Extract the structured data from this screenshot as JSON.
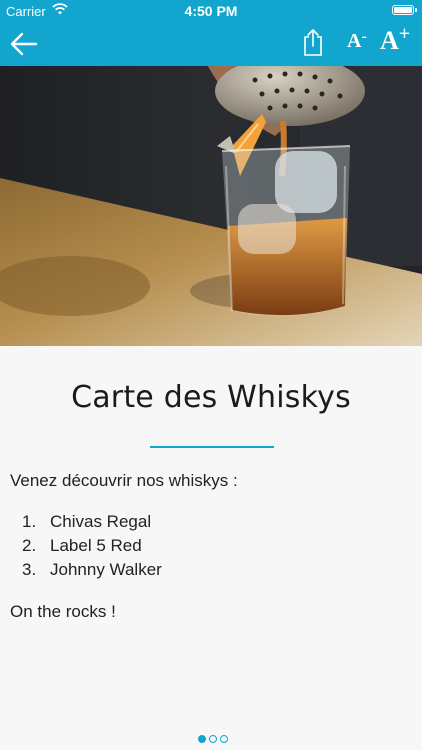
{
  "status_bar": {
    "carrier": "Carrier",
    "time": "4:50 PM"
  },
  "nav": {
    "back_icon": "arrow-left-icon",
    "share_icon": "share-icon",
    "font_decrease_label": "A",
    "font_decrease_sign": "-",
    "font_increase_label": "A",
    "font_increase_sign": "+"
  },
  "article": {
    "title": "Carte des Whiskys",
    "intro": "Venez découvrir nos whiskys :",
    "items": [
      {
        "num": "1.",
        "name": "Chivas Regal"
      },
      {
        "num": "2.",
        "name": "Label 5 Red"
      },
      {
        "num": "3.",
        "name": "Johnny Walker"
      }
    ],
    "outro": "On the rocks !"
  },
  "pager": {
    "total": 3,
    "current": 1
  },
  "colors": {
    "accent": "#12a6cf",
    "background": "#f7f7f7",
    "text": "#222222"
  }
}
